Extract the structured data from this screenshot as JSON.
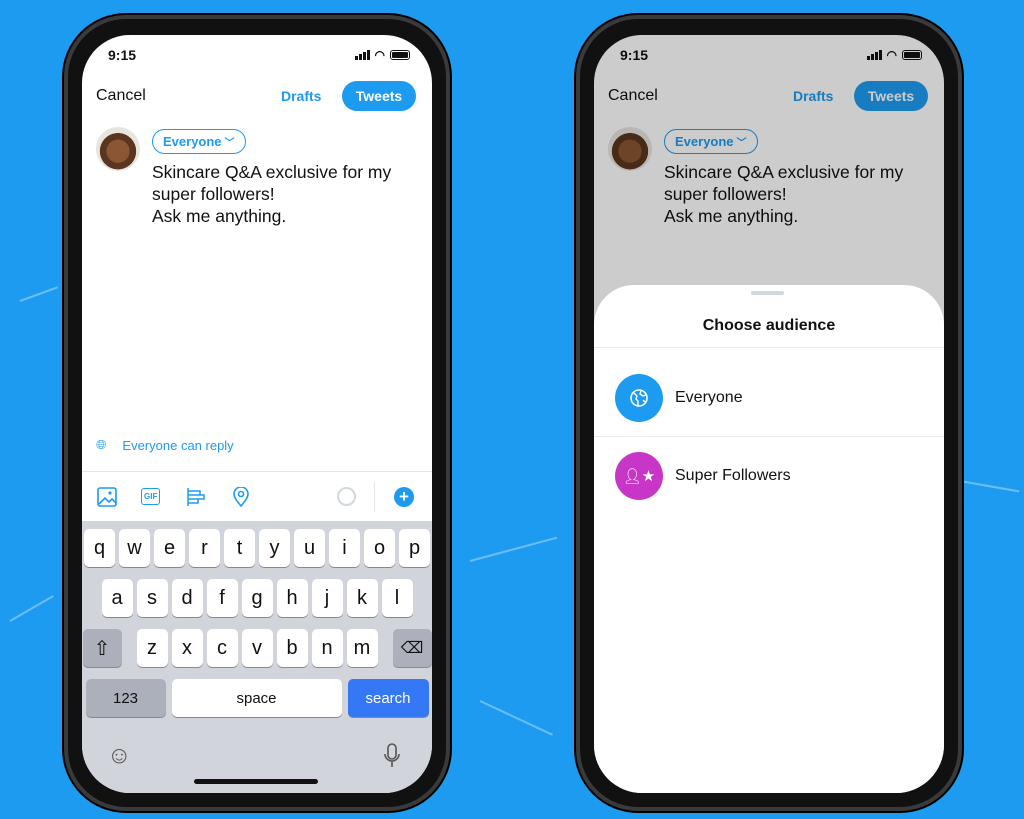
{
  "colors": {
    "accent": "#1d9bf0",
    "super": "#c836c8",
    "background": "#1d9bf0"
  },
  "status": {
    "time": "9:15"
  },
  "compose": {
    "cancel": "Cancel",
    "drafts": "Drafts",
    "tweet_button": "Tweets",
    "audience": "Everyone",
    "text": "Skincare Q&A exclusive for my\nsuper followers!\nAsk me anything.",
    "reply_setting": "Everyone can reply",
    "gif": "GIF"
  },
  "keyboard": {
    "rows": [
      [
        "q",
        "w",
        "e",
        "r",
        "t",
        "y",
        "u",
        "i",
        "o",
        "p"
      ],
      [
        "a",
        "s",
        "d",
        "f",
        "g",
        "h",
        "j",
        "k",
        "l"
      ],
      [
        "z",
        "x",
        "c",
        "v",
        "b",
        "n",
        "m"
      ]
    ],
    "numbers": "123",
    "space": "space",
    "search": "search"
  },
  "sheet": {
    "title": "Choose audience",
    "options": [
      {
        "label": "Everyone",
        "icon": "globe-icon"
      },
      {
        "label": "Super Followers",
        "icon": "user-star-icon"
      }
    ]
  }
}
